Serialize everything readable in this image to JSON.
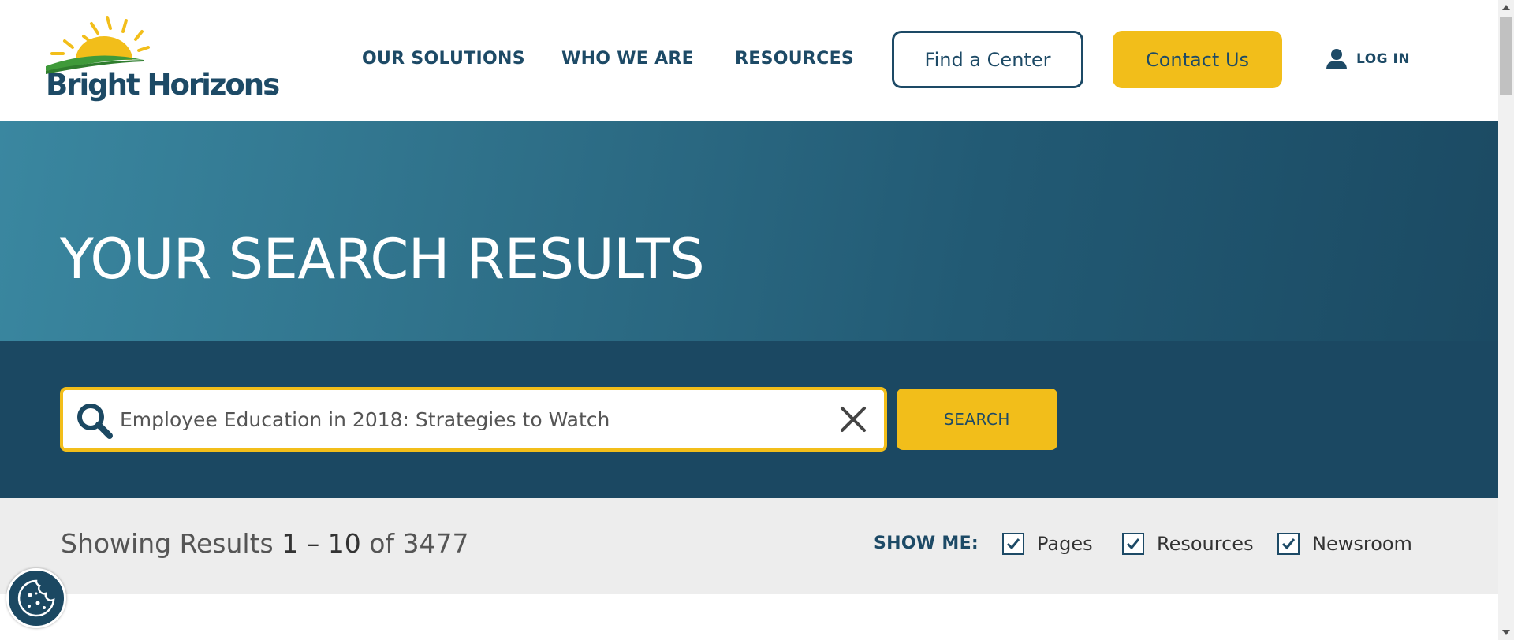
{
  "brand": {
    "name": "Bright Horizons",
    "trademark": "TM",
    "colors": {
      "navy": "#1d4a66",
      "gold": "#f2be1a",
      "green": "#3f9a3a"
    }
  },
  "nav": {
    "items": [
      {
        "label": "OUR SOLUTIONS"
      },
      {
        "label": "WHO WE ARE"
      },
      {
        "label": "RESOURCES"
      }
    ],
    "find_center_label": "Find a Center",
    "contact_label": "Contact Us",
    "login_label": "LOG IN",
    "login_icon": "user-icon"
  },
  "hero": {
    "title": "YOUR SEARCH RESULTS"
  },
  "search": {
    "value": "Employee Education in 2018: Strategies to Watch",
    "button_label": "SEARCH",
    "icons": [
      "search-icon",
      "close-icon"
    ]
  },
  "results": {
    "prefix": "Showing Results",
    "range_start": "1",
    "range_sep": "–",
    "range_end": "10",
    "of_label": "of",
    "total": "3477"
  },
  "filters": {
    "label": "SHOW ME:",
    "options": [
      {
        "label": "Pages",
        "checked": true
      },
      {
        "label": "Resources",
        "checked": true
      },
      {
        "label": "Newsroom",
        "checked": true
      }
    ]
  },
  "cookie": {
    "icon": "cookie-icon"
  }
}
